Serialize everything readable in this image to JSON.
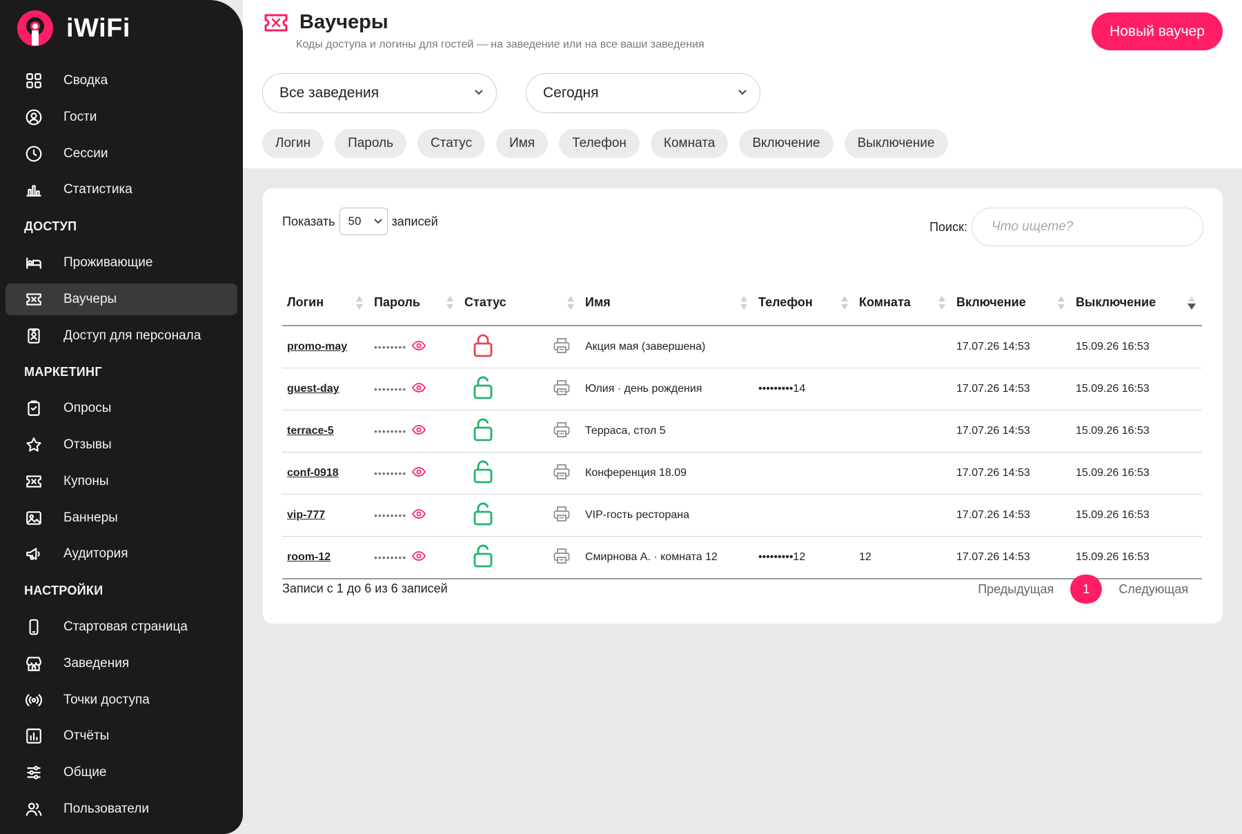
{
  "app": {
    "name": "iWiFi"
  },
  "sidebar": {
    "items": [
      {
        "label": "Сводка",
        "icon": "dashboard-icon"
      },
      {
        "label": "Гости",
        "icon": "user-circle-icon"
      },
      {
        "label": "Сессии",
        "icon": "clock-icon"
      },
      {
        "label": "Статистика",
        "icon": "bar-chart-icon"
      },
      {
        "section": "ДОСТУП"
      },
      {
        "label": "Проживающие",
        "icon": "bed-icon"
      },
      {
        "label": "Ваучеры",
        "icon": "ticket-icon",
        "active": true
      },
      {
        "label": "Доступ для персонала",
        "icon": "badge-icon"
      },
      {
        "section": "МАРКЕТИНГ"
      },
      {
        "label": "Опросы",
        "icon": "clipboard-icon"
      },
      {
        "label": "Отзывы",
        "icon": "star-icon"
      },
      {
        "label": "Купоны",
        "icon": "coupon-icon"
      },
      {
        "label": "Баннеры",
        "icon": "image-icon"
      },
      {
        "label": "Аудитория",
        "icon": "megaphone-icon"
      },
      {
        "section": "НАСТРОЙКИ"
      },
      {
        "label": "Стартовая страница",
        "icon": "phone-icon"
      },
      {
        "label": "Заведения",
        "icon": "store-icon"
      },
      {
        "label": "Точки доступа",
        "icon": "wifi-signal-icon"
      },
      {
        "label": "Отчёты",
        "icon": "report-icon"
      },
      {
        "label": "Общие",
        "icon": "sliders-icon"
      },
      {
        "label": "Пользователи",
        "icon": "users-icon"
      }
    ]
  },
  "header": {
    "title": "Ваучеры",
    "subtitle": "Коды доступа и логины для гостей — на заведение или на все ваши заведения",
    "new_button": "Новый ваучер",
    "venue_filter": "Все заведения",
    "date_filter": "Сегодня",
    "chips": [
      "Логин",
      "Пароль",
      "Статус",
      "Имя",
      "Телефон",
      "Комната",
      "Включение",
      "Выключение"
    ]
  },
  "table_controls": {
    "show_label": "Показать",
    "page_length": "50",
    "entries_label": "записей",
    "search_label": "Поиск:",
    "search_placeholder": "Что ищете?"
  },
  "table": {
    "columns": [
      "Логин",
      "Пароль",
      "Статус",
      "Имя",
      "Телефон",
      "Комната",
      "Включение",
      "Выключение"
    ],
    "rows": [
      {
        "login": "promo-may",
        "password": "••••••••",
        "status": "locked",
        "name": "Акция мая (завершена)",
        "phone": "",
        "room": "",
        "on": "17.07.26 14:53",
        "off": "15.09.26 16:53"
      },
      {
        "login": "guest-day",
        "password": "••••••••",
        "status": "unlocked",
        "name": "Юлия · день рождения",
        "phone": "•••••••••14",
        "room": "",
        "on": "17.07.26 14:53",
        "off": "15.09.26 16:53"
      },
      {
        "login": "terrace-5",
        "password": "••••••••",
        "status": "unlocked",
        "name": "Терраса, стол 5",
        "phone": "",
        "room": "",
        "on": "17.07.26 14:53",
        "off": "15.09.26 16:53"
      },
      {
        "login": "conf-0918",
        "password": "••••••••",
        "status": "unlocked",
        "name": "Конференция 18.09",
        "phone": "",
        "room": "",
        "on": "17.07.26 14:53",
        "off": "15.09.26 16:53"
      },
      {
        "login": "vip-777",
        "password": "••••••••",
        "status": "unlocked",
        "name": "VIP-гость ресторана",
        "phone": "",
        "room": "",
        "on": "17.07.26 14:53",
        "off": "15.09.26 16:53"
      },
      {
        "login": "room-12",
        "password": "••••••••",
        "status": "unlocked",
        "name": "Смирнова А. · комната 12",
        "phone": "•••••••••12",
        "room": "12",
        "on": "17.07.26 14:53",
        "off": "15.09.26 16:53"
      }
    ]
  },
  "footer": {
    "info": "Записи с 1 до 6 из 6 записей",
    "prev": "Предыдущая",
    "page": "1",
    "next": "Следующая"
  },
  "colors": {
    "accent": "#ff1e64",
    "locked": "#e2474b",
    "unlocked": "#21b36b",
    "sidebar": "#1b1b1b"
  }
}
